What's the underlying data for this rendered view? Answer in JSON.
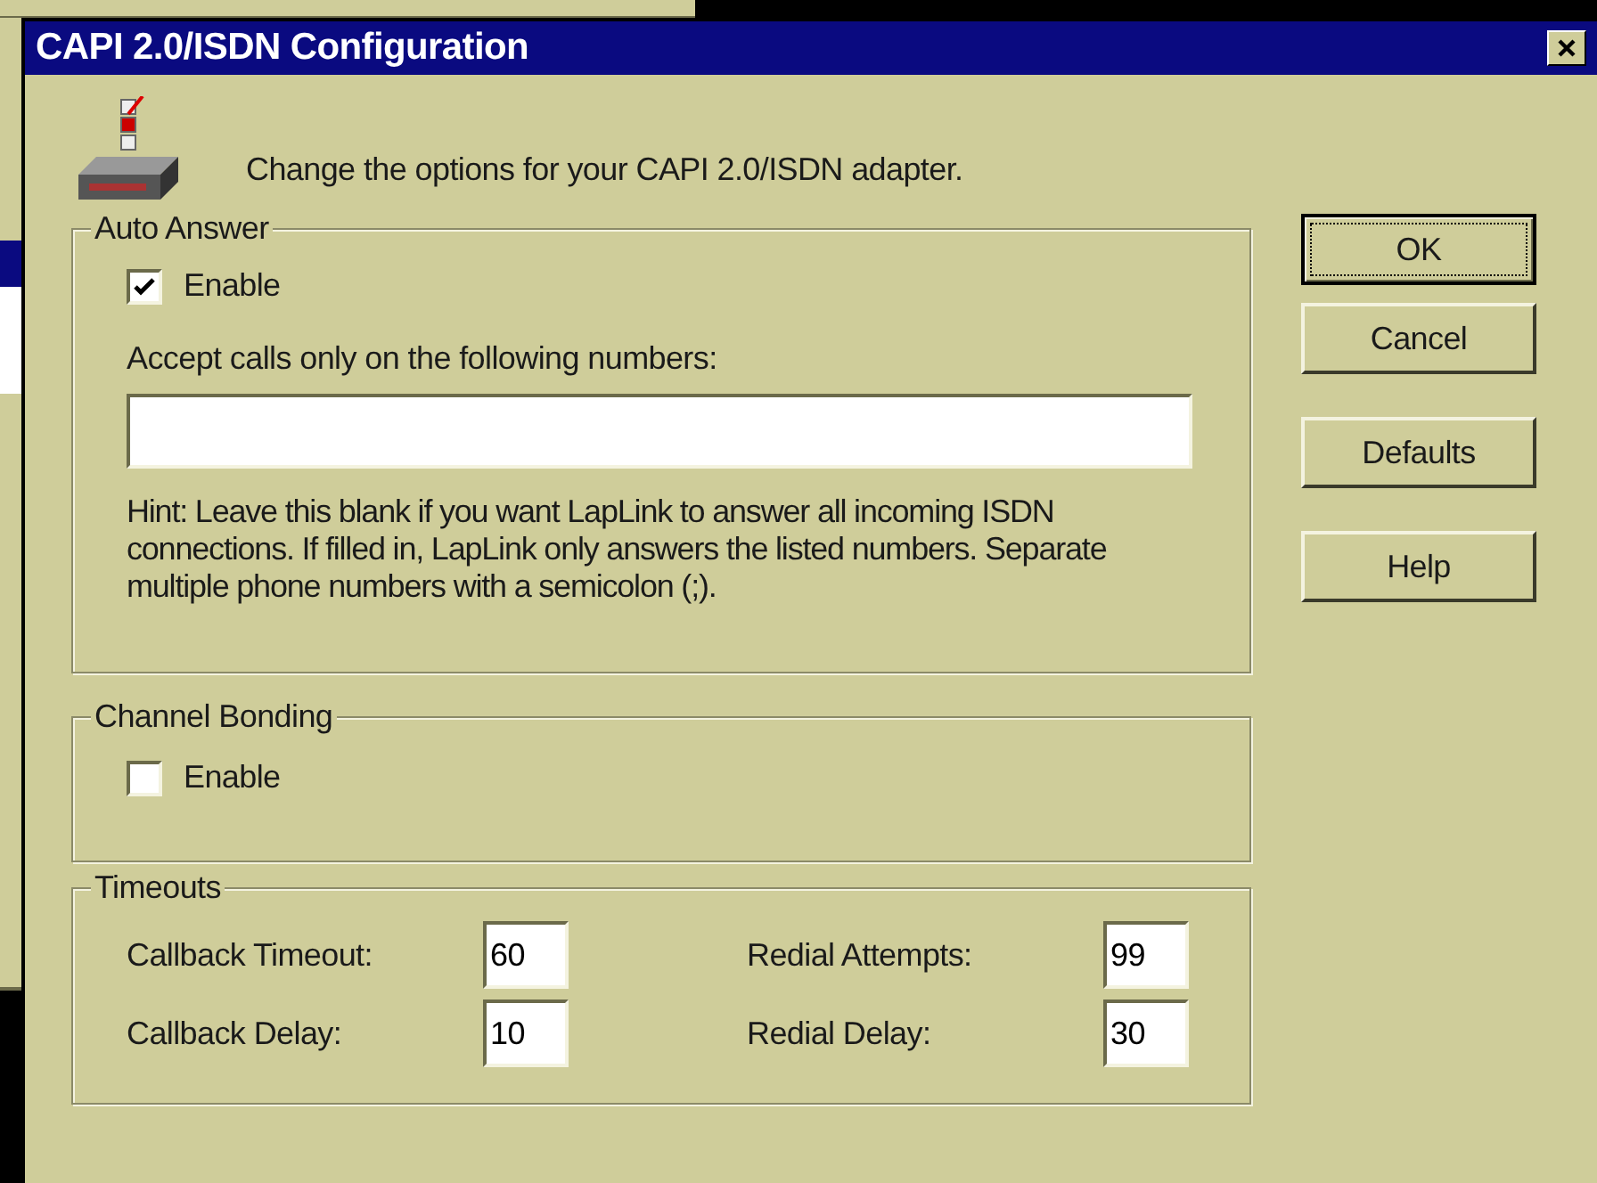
{
  "window": {
    "title": "CAPI 2.0/ISDN Configuration"
  },
  "intro": "Change the options for your CAPI 2.0/ISDN adapter.",
  "auto_answer": {
    "title": "Auto Answer",
    "enable": {
      "label": "Enable",
      "checked": true
    },
    "numbers_label": "Accept calls only on the following numbers:",
    "hint": "Hint: Leave this blank if you want LapLink to answer all incoming ISDN connections.  If filled in, LapLink only answers the listed numbers.  Separate multiple phone numbers with a semicolon (;)."
  },
  "channel_bonding": {
    "title": "Channel Bonding",
    "enable": {
      "label": "Enable",
      "checked": false
    }
  },
  "timeouts": {
    "title": "Timeouts",
    "fields": [
      {
        "label": "Callback Timeout:",
        "value": "60"
      },
      {
        "label": "Redial Attempts:",
        "value": "99"
      },
      {
        "label": "Callback Delay:",
        "value": "10"
      },
      {
        "label": "Redial Delay:",
        "value": "30"
      }
    ]
  },
  "buttons": [
    {
      "label": "OK",
      "default": true
    },
    {
      "label": "Cancel",
      "default": false
    },
    {
      "label": "Defaults",
      "default": false
    },
    {
      "label": "Help",
      "default": false
    }
  ]
}
